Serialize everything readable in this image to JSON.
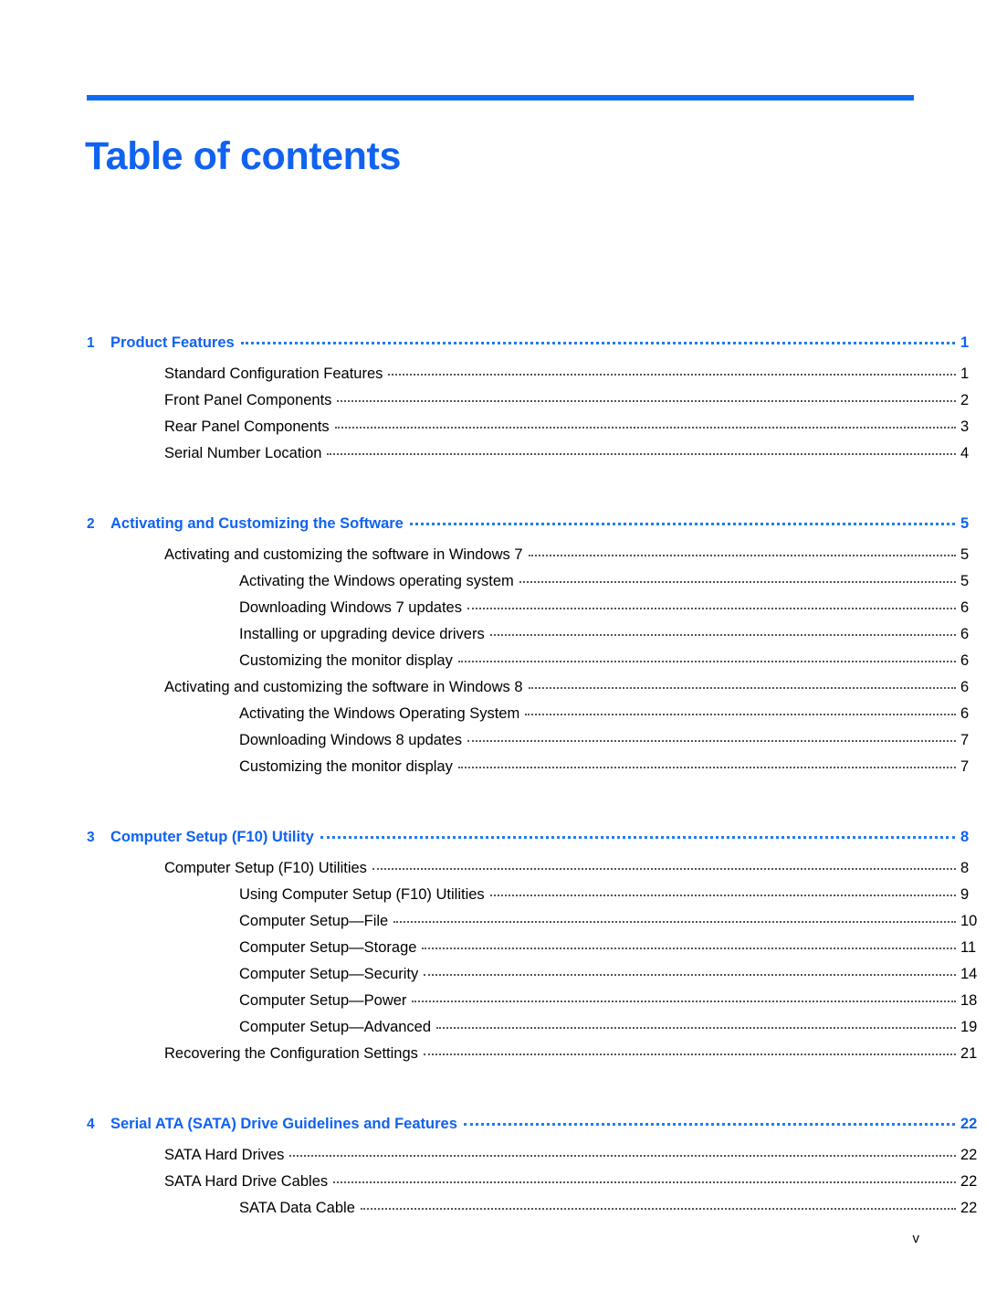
{
  "document": {
    "title": "Table of contents",
    "footer_page_label": "v",
    "accent_color": "#1062f0",
    "rule_color": "#0d6ef5",
    "body_text_color": "#000000"
  },
  "toc": {
    "chapters": [
      {
        "number": "1",
        "title": "Product Features",
        "page": "1",
        "entries": [
          {
            "level": 1,
            "label": "Standard Configuration Features",
            "page": "1"
          },
          {
            "level": 1,
            "label": "Front Panel Components",
            "page": "2"
          },
          {
            "level": 1,
            "label": "Rear Panel Components",
            "page": "3"
          },
          {
            "level": 1,
            "label": "Serial Number Location",
            "page": "4"
          }
        ]
      },
      {
        "number": "2",
        "title": "Activating and Customizing the Software",
        "page": "5",
        "entries": [
          {
            "level": 1,
            "label": "Activating and customizing the software in Windows 7",
            "page": "5"
          },
          {
            "level": 2,
            "label": "Activating the Windows operating system",
            "page": "5"
          },
          {
            "level": 2,
            "label": "Downloading Windows 7 updates",
            "page": "6"
          },
          {
            "level": 2,
            "label": "Installing or upgrading device drivers",
            "page": "6"
          },
          {
            "level": 2,
            "label": "Customizing the monitor display",
            "page": "6"
          },
          {
            "level": 1,
            "label": "Activating and customizing the software in Windows 8",
            "page": "6"
          },
          {
            "level": 2,
            "label": "Activating the Windows Operating System",
            "page": "6"
          },
          {
            "level": 2,
            "label": "Downloading Windows 8 updates",
            "page": "7"
          },
          {
            "level": 2,
            "label": "Customizing the monitor display",
            "page": "7"
          }
        ]
      },
      {
        "number": "3",
        "title": "Computer Setup (F10) Utility",
        "page": "8",
        "entries": [
          {
            "level": 1,
            "label": "Computer Setup (F10) Utilities",
            "page": "8"
          },
          {
            "level": 2,
            "label": "Using Computer Setup (F10) Utilities",
            "page": "9"
          },
          {
            "level": 2,
            "label": "Computer Setup—File",
            "page": "10"
          },
          {
            "level": 2,
            "label": "Computer Setup—Storage",
            "page": "11"
          },
          {
            "level": 2,
            "label": "Computer Setup—Security",
            "page": "14"
          },
          {
            "level": 2,
            "label": "Computer Setup—Power",
            "page": "18"
          },
          {
            "level": 2,
            "label": "Computer Setup—Advanced",
            "page": "19"
          },
          {
            "level": 1,
            "label": "Recovering the Configuration Settings",
            "page": "21"
          }
        ]
      },
      {
        "number": "4",
        "title": "Serial ATA (SATA) Drive Guidelines and Features",
        "page": "22",
        "entries": [
          {
            "level": 1,
            "label": "SATA Hard Drives",
            "page": "22"
          },
          {
            "level": 1,
            "label": "SATA Hard Drive Cables",
            "page": "22"
          },
          {
            "level": 2,
            "label": "SATA Data Cable",
            "page": "22"
          }
        ]
      }
    ]
  }
}
